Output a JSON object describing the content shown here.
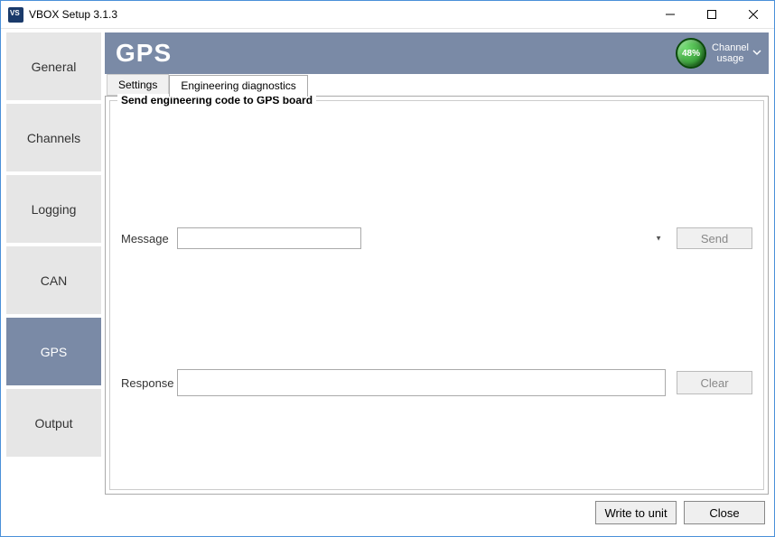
{
  "window": {
    "title": "VBOX Setup 3.1.3"
  },
  "sidebar": {
    "items": [
      {
        "label": "General"
      },
      {
        "label": "Channels"
      },
      {
        "label": "Logging"
      },
      {
        "label": "CAN"
      },
      {
        "label": "GPS"
      },
      {
        "label": "Output"
      }
    ],
    "active_index": 4
  },
  "banner": {
    "title": "GPS",
    "gauge_pct": "48%",
    "channel_usage_line1": "Channel",
    "channel_usage_line2": "usage"
  },
  "tabs": {
    "items": [
      {
        "label": "Settings"
      },
      {
        "label": "Engineering diagnostics"
      }
    ],
    "active_index": 1
  },
  "group": {
    "legend": "Send engineering code to GPS board"
  },
  "form": {
    "message_label": "Message",
    "message_value": "",
    "send_label": "Send",
    "response_label": "Response",
    "response_value": "",
    "clear_label": "Clear"
  },
  "footer": {
    "write_label": "Write to unit",
    "close_label": "Close"
  },
  "colors": {
    "sidebar_active": "#7a8aa6",
    "banner": "#7a8aa6"
  }
}
